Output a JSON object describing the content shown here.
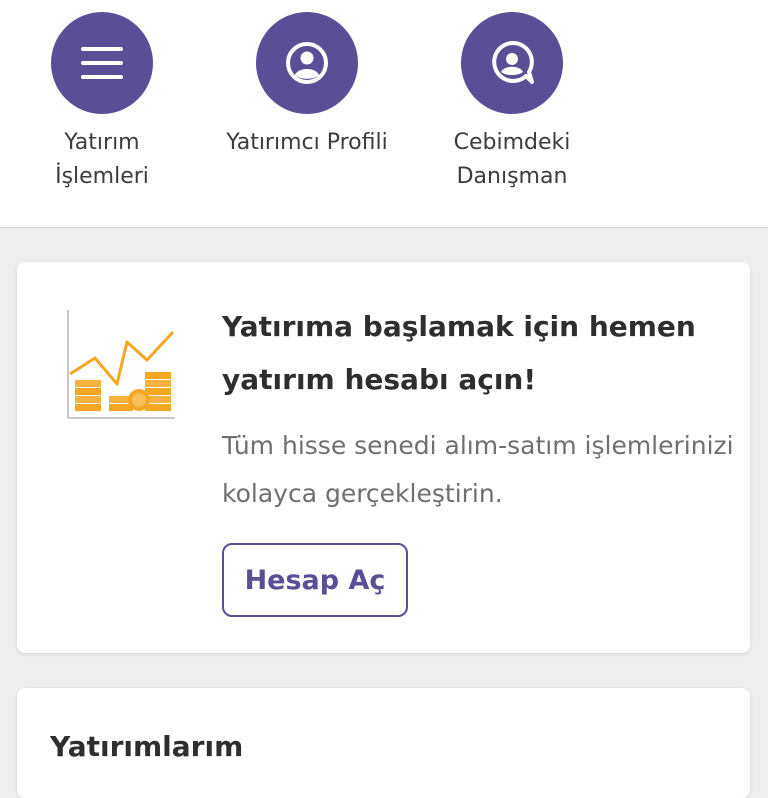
{
  "quick_actions": [
    {
      "label": "Yatırım\nİşlemleri",
      "icon": "menu-icon"
    },
    {
      "label": "Yatırımcı Profili",
      "icon": "user-profile-icon"
    },
    {
      "label": "Cebimdeki\nDanışman",
      "icon": "advisor-chat-icon"
    }
  ],
  "promo": {
    "title": "Yatırıma başlamak için hemen yatırım hesabı açın!",
    "description": "Tüm hisse senedi alım-satım işlemlerinizi kolayca gerçekleştirin.",
    "button_label": "Hesap Aç",
    "illustration": "growth-chart-coins-icon"
  },
  "investments": {
    "title": "Yatırımlarım"
  },
  "colors": {
    "accent": "#5a4e96",
    "illustration_orange": "#f5a623",
    "background": "#eeeeee"
  }
}
